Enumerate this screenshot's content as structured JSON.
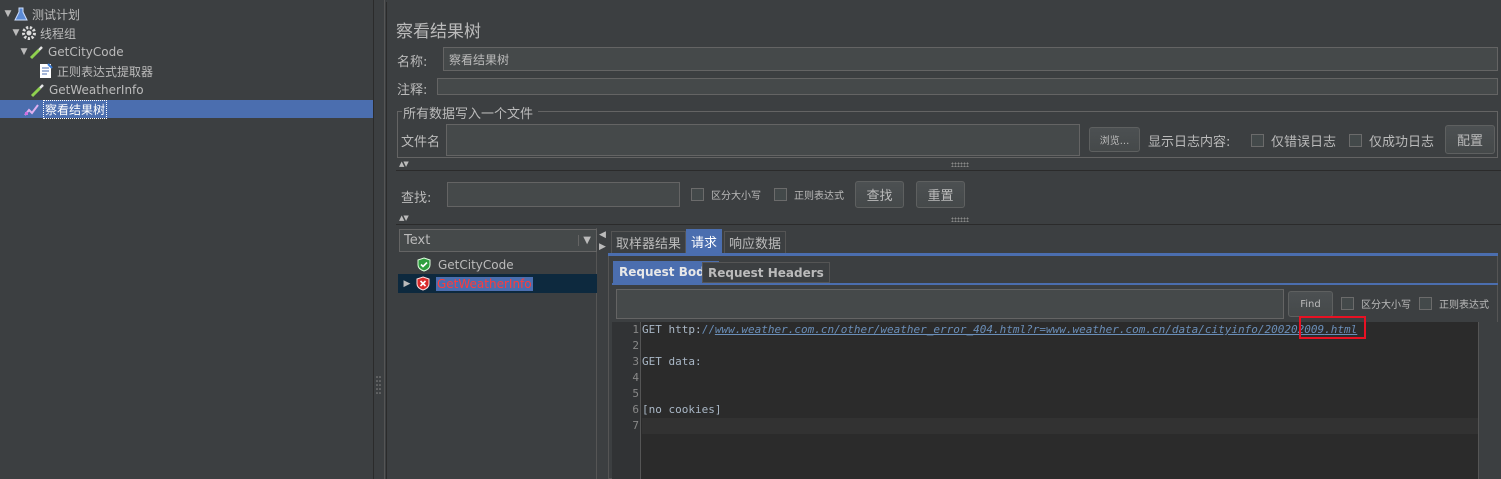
{
  "tree": {
    "nodes": [
      {
        "label": "测试计划",
        "icon": "flask-icon"
      },
      {
        "label": "线程组",
        "icon": "gear-icon"
      },
      {
        "label": "GetCityCode",
        "icon": "pipette-icon"
      },
      {
        "label": "正则表达式提取器",
        "icon": "document-icon"
      },
      {
        "label": "GetWeatherInfo",
        "icon": "pipette-icon"
      },
      {
        "label": "察看结果树",
        "icon": "chart-icon"
      }
    ]
  },
  "panel": {
    "title": "察看结果树",
    "name_label": "名称:",
    "name_value": "察看结果树",
    "comment_label": "注释:",
    "file_section_title": "所有数据写入一个文件",
    "filename_label": "文件名",
    "browse_button": "浏览...",
    "log_content_label": "显示日志内容:",
    "errors_only": "仅错误日志",
    "success_only": "仅成功日志",
    "configure_button": "配置",
    "search_label": "查找:",
    "case_sensitive": "区分大小写",
    "regex": "正则表达式",
    "find_button": "查找",
    "reset_button": "重置"
  },
  "renderer": {
    "selected": "Text",
    "results": [
      {
        "label": "GetCityCode",
        "status": "success"
      },
      {
        "label": "GetWeatherInfo",
        "status": "error"
      }
    ]
  },
  "tabs": [
    "取样器结果",
    "请求",
    "响应数据"
  ],
  "subtabs": [
    "Request Body",
    "Request Headers"
  ],
  "inner_search": {
    "find_button": "Find",
    "case_sensitive": "区分大小写",
    "regex": "正则表达式"
  },
  "editor": {
    "line_numbers": [
      "1",
      "2",
      "3",
      "4",
      "5",
      "6",
      "7"
    ],
    "line1_prefix": "GET http:",
    "line1_slashes": "//",
    "line1_url": "www.weather.com.cn/other/weather_error_404.html?r=www.weather.com.cn/data/cityinfo/",
    "line1_code": "200202009",
    "line1_suffix": ".html",
    "line3": "GET data:",
    "line6": "[no cookies]"
  },
  "colors": {
    "selection": "#4b6eaf",
    "error_text": "#ff3b3b",
    "success": "#2e9e3e",
    "highlight": "#e81123"
  }
}
